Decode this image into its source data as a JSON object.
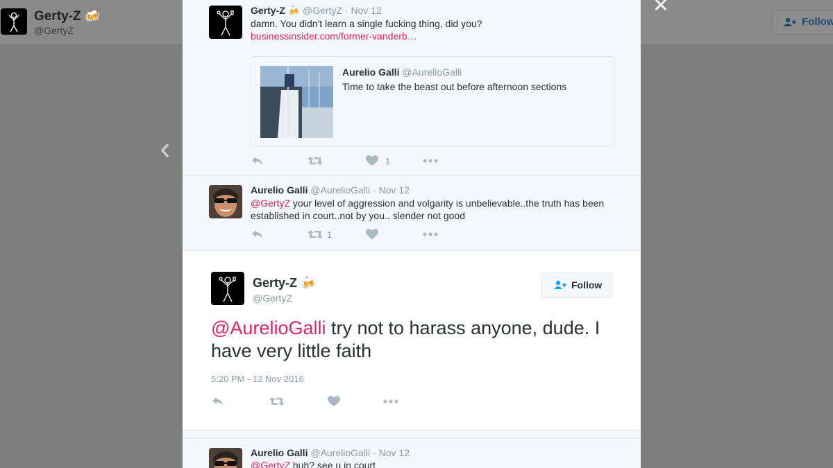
{
  "background": {
    "profile_name": "Gerty-Z",
    "profile_handle": "@GertyZ",
    "follow_label": "Follow",
    "close_symbol": "✕"
  },
  "tweets": [
    {
      "name": "Gerty-Z",
      "emoji": "🍻",
      "handle": "@GertyZ",
      "date": "Nov 12",
      "text": "damn. You didn't learn a single fucking thing, did you?",
      "link": "businessinsider.com/former-vanderb…",
      "quote": {
        "name": "Aurelio Galli",
        "handle": "@AurelioGalli",
        "text": "Time to take the beast out before afternoon sections"
      },
      "likes": "1"
    },
    {
      "name": "Aurelio Galli",
      "handle": "@AurelioGalli",
      "date": "Nov 12",
      "mention": "@GertyZ",
      "text": "your level of aggression and volgarity is unbelievable..the truth has been established in court..not by you.. slender  not good",
      "retweets": "1"
    }
  ],
  "main_tweet": {
    "name": "Gerty-Z",
    "emoji": "🍻",
    "handle": "@GertyZ",
    "follow_label": "Follow",
    "mention": "@AurelioGalli",
    "text": "try not to harass anyone, dude. I have very little faith",
    "timestamp": "5:20 PM - 12 Nov 2016"
  },
  "reply": {
    "name": "Aurelio Galli",
    "handle": "@AurelioGalli",
    "date": "Nov 12",
    "mention": "@GertyZ",
    "text": "huh?  see u in court"
  },
  "colors": {
    "mention": "#e0245e",
    "icon": "#aab8c2",
    "follow_icon": "#1da1f2"
  }
}
